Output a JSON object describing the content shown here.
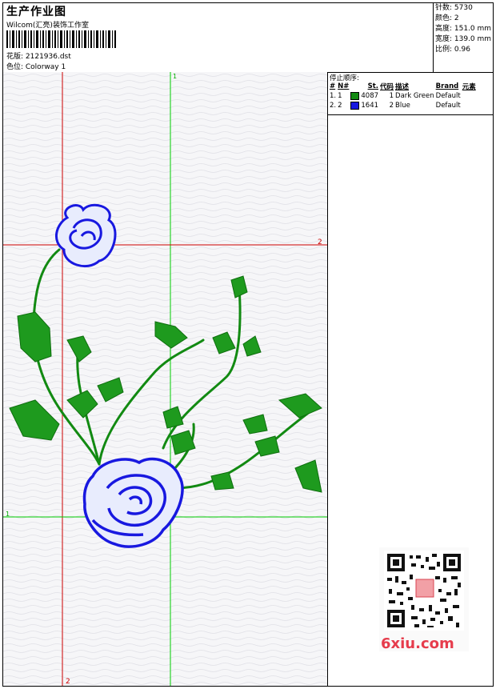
{
  "header": {
    "title": "生产作业图",
    "company": "Wilcom(汇亮)装饰工作室",
    "pattern": "花版: 2121936.dst",
    "colorway": "色位: Colorway 1"
  },
  "stats": {
    "stitches": "针数: 5730",
    "colors": "颜色: 2",
    "height": "高度: 151.0 mm",
    "width": "宽度: 139.0 mm",
    "scale": "比例: 0.96"
  },
  "stop_sequence": {
    "title": "停止顺序:",
    "headers": [
      "#",
      "N#",
      "St.",
      "代码",
      "描述",
      "Brand",
      "元素"
    ],
    "rows": [
      {
        "num": "1.",
        "n": "1",
        "st": "4087",
        "code": "1",
        "desc": "Dark Green",
        "brand": "Default",
        "color": "#128a12"
      },
      {
        "num": "2.",
        "n": "2",
        "st": "1641",
        "code": "2",
        "desc": "Blue",
        "brand": "Default",
        "color": "#1818e0"
      }
    ]
  },
  "guides": {
    "v_green": "1",
    "h_red": "2",
    "h_green": "1",
    "v_red": "2"
  },
  "watermark": "6xiu.com",
  "colors_used": {
    "green": "#128a12",
    "blue": "#1818e0",
    "red_guide": "#cc0000",
    "green_guide": "#00cc00"
  }
}
